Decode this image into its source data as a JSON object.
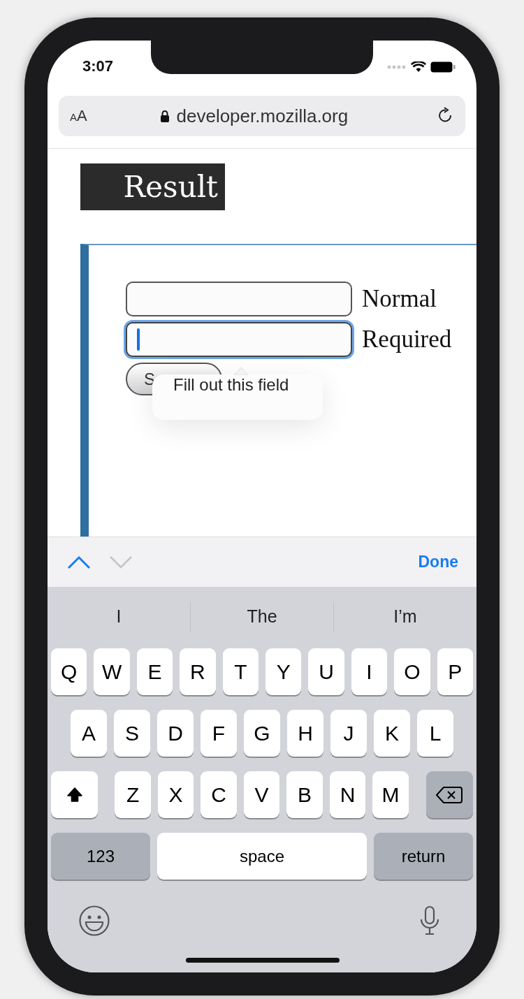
{
  "status_bar": {
    "time": "3:07"
  },
  "address_bar": {
    "text_size_button": "AA",
    "secure": true,
    "url": "developer.mozilla.org"
  },
  "page": {
    "heading": "Result",
    "fields": [
      {
        "label": "Normal",
        "focused": false
      },
      {
        "label": "Required",
        "focused": true
      }
    ],
    "submit_button": "S",
    "tooltip": "Fill out this field"
  },
  "form_accessory": {
    "previous_enabled": true,
    "next_enabled": false,
    "done": "Done"
  },
  "keyboard": {
    "suggestions": [
      "I",
      "The",
      "I’m"
    ],
    "rows": [
      [
        {
          "kind": "letter",
          "label": "Q"
        },
        {
          "kind": "letter",
          "label": "W"
        },
        {
          "kind": "letter",
          "label": "E"
        },
        {
          "kind": "letter",
          "label": "R"
        },
        {
          "kind": "letter",
          "label": "T"
        },
        {
          "kind": "letter",
          "label": "Y"
        },
        {
          "kind": "letter",
          "label": "U"
        },
        {
          "kind": "letter",
          "label": "I"
        },
        {
          "kind": "letter",
          "label": "O"
        },
        {
          "kind": "letter",
          "label": "P"
        }
      ],
      [
        {
          "kind": "letter",
          "label": "A"
        },
        {
          "kind": "letter",
          "label": "S"
        },
        {
          "kind": "letter",
          "label": "D"
        },
        {
          "kind": "letter",
          "label": "F"
        },
        {
          "kind": "letter",
          "label": "G"
        },
        {
          "kind": "letter",
          "label": "H"
        },
        {
          "kind": "letter",
          "label": "J"
        },
        {
          "kind": "letter",
          "label": "K"
        },
        {
          "kind": "letter",
          "label": "L"
        }
      ],
      [
        {
          "kind": "shift",
          "on": true
        },
        {
          "kind": "letter",
          "label": "Z"
        },
        {
          "kind": "letter",
          "label": "X"
        },
        {
          "kind": "letter",
          "label": "C"
        },
        {
          "kind": "letter",
          "label": "V"
        },
        {
          "kind": "letter",
          "label": "B"
        },
        {
          "kind": "letter",
          "label": "N"
        },
        {
          "kind": "letter",
          "label": "M"
        },
        {
          "kind": "delete"
        }
      ]
    ],
    "bottom_row": [
      {
        "kind": "mode",
        "label": "123"
      },
      {
        "kind": "space",
        "label": "space"
      },
      {
        "kind": "mode",
        "label": "return"
      }
    ]
  }
}
